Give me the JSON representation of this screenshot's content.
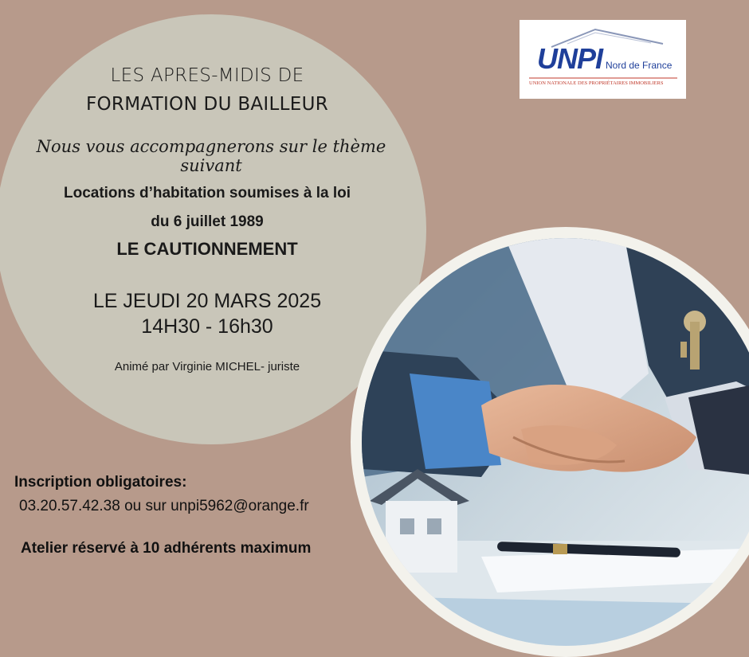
{
  "header": {
    "title_line1": "LES APRES-MIDIS DE",
    "title_line2": "FORMATION DU BAILLEUR",
    "subtitle": "Nous vous accompagnerons sur le thème suivant"
  },
  "topic": {
    "line1": "Locations d’habitation soumises à la loi",
    "line2": "du 6 juillet 1989",
    "line3": "LE CAUTIONNEMENT"
  },
  "event": {
    "date": "LE JEUDI 20 MARS 2025",
    "time": "14H30 - 16h30",
    "animator": "Animé par Virginie MICHEL- juriste"
  },
  "registration": {
    "label": "Inscription obligatoires:",
    "contact": "03.20.57.42.38 ou sur unpi5962@orange.fr",
    "note": "Atelier réservé à 10 adhérents maximum"
  },
  "logo": {
    "word": "UNPI",
    "region": "Nord de France",
    "union": "UNION NATIONALE DES PROPRIÉTAIRES IMMOBILIERS"
  },
  "colors": {
    "background": "#b79a8b",
    "circle": "#c9c6b9",
    "logo_blue": "#1f3f9a",
    "logo_red": "#c0392b"
  },
  "icons": [
    "handshake-photo",
    "house-model",
    "keys",
    "pen"
  ]
}
